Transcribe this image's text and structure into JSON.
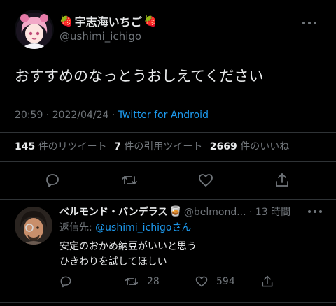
{
  "main_tweet": {
    "display_name": "宇志海いちご",
    "name_left_emoji": "🍓",
    "name_right_emoji": "🍓",
    "handle": "@ushimi_ichigo",
    "text": "おすすめのなっとうおしえてください",
    "time": "20:59 · 2022/04/24 · ",
    "source": "Twitter for Android",
    "retweets_count": "145",
    "retweets_label": "件のリツイート",
    "quotes_count": "7",
    "quotes_label": "件の引用ツイート",
    "likes_count": "2669",
    "likes_label": "件のいいね"
  },
  "reply": {
    "display_name": "ベルモンド・バンデラス",
    "name_emoji": "🥃",
    "handle_time": "@belmond... · 13 時間",
    "replying_prefix": "返信先: ",
    "replying_handle": "@ushimi_ichigo",
    "replying_suffix": "さん",
    "text_line1": "安定のおかめ納豆がいいと思う",
    "text_line2": "ひきわりを試してほしい",
    "retweets": "28",
    "likes": "594"
  },
  "colors": {
    "background": "#000000",
    "text": "#e7e9ea",
    "muted": "#71767b",
    "accent": "#1d9bf0",
    "divider": "#2f3336"
  },
  "icons": [
    "more-icon",
    "reply-icon",
    "retweet-icon",
    "like-icon",
    "share-icon"
  ]
}
